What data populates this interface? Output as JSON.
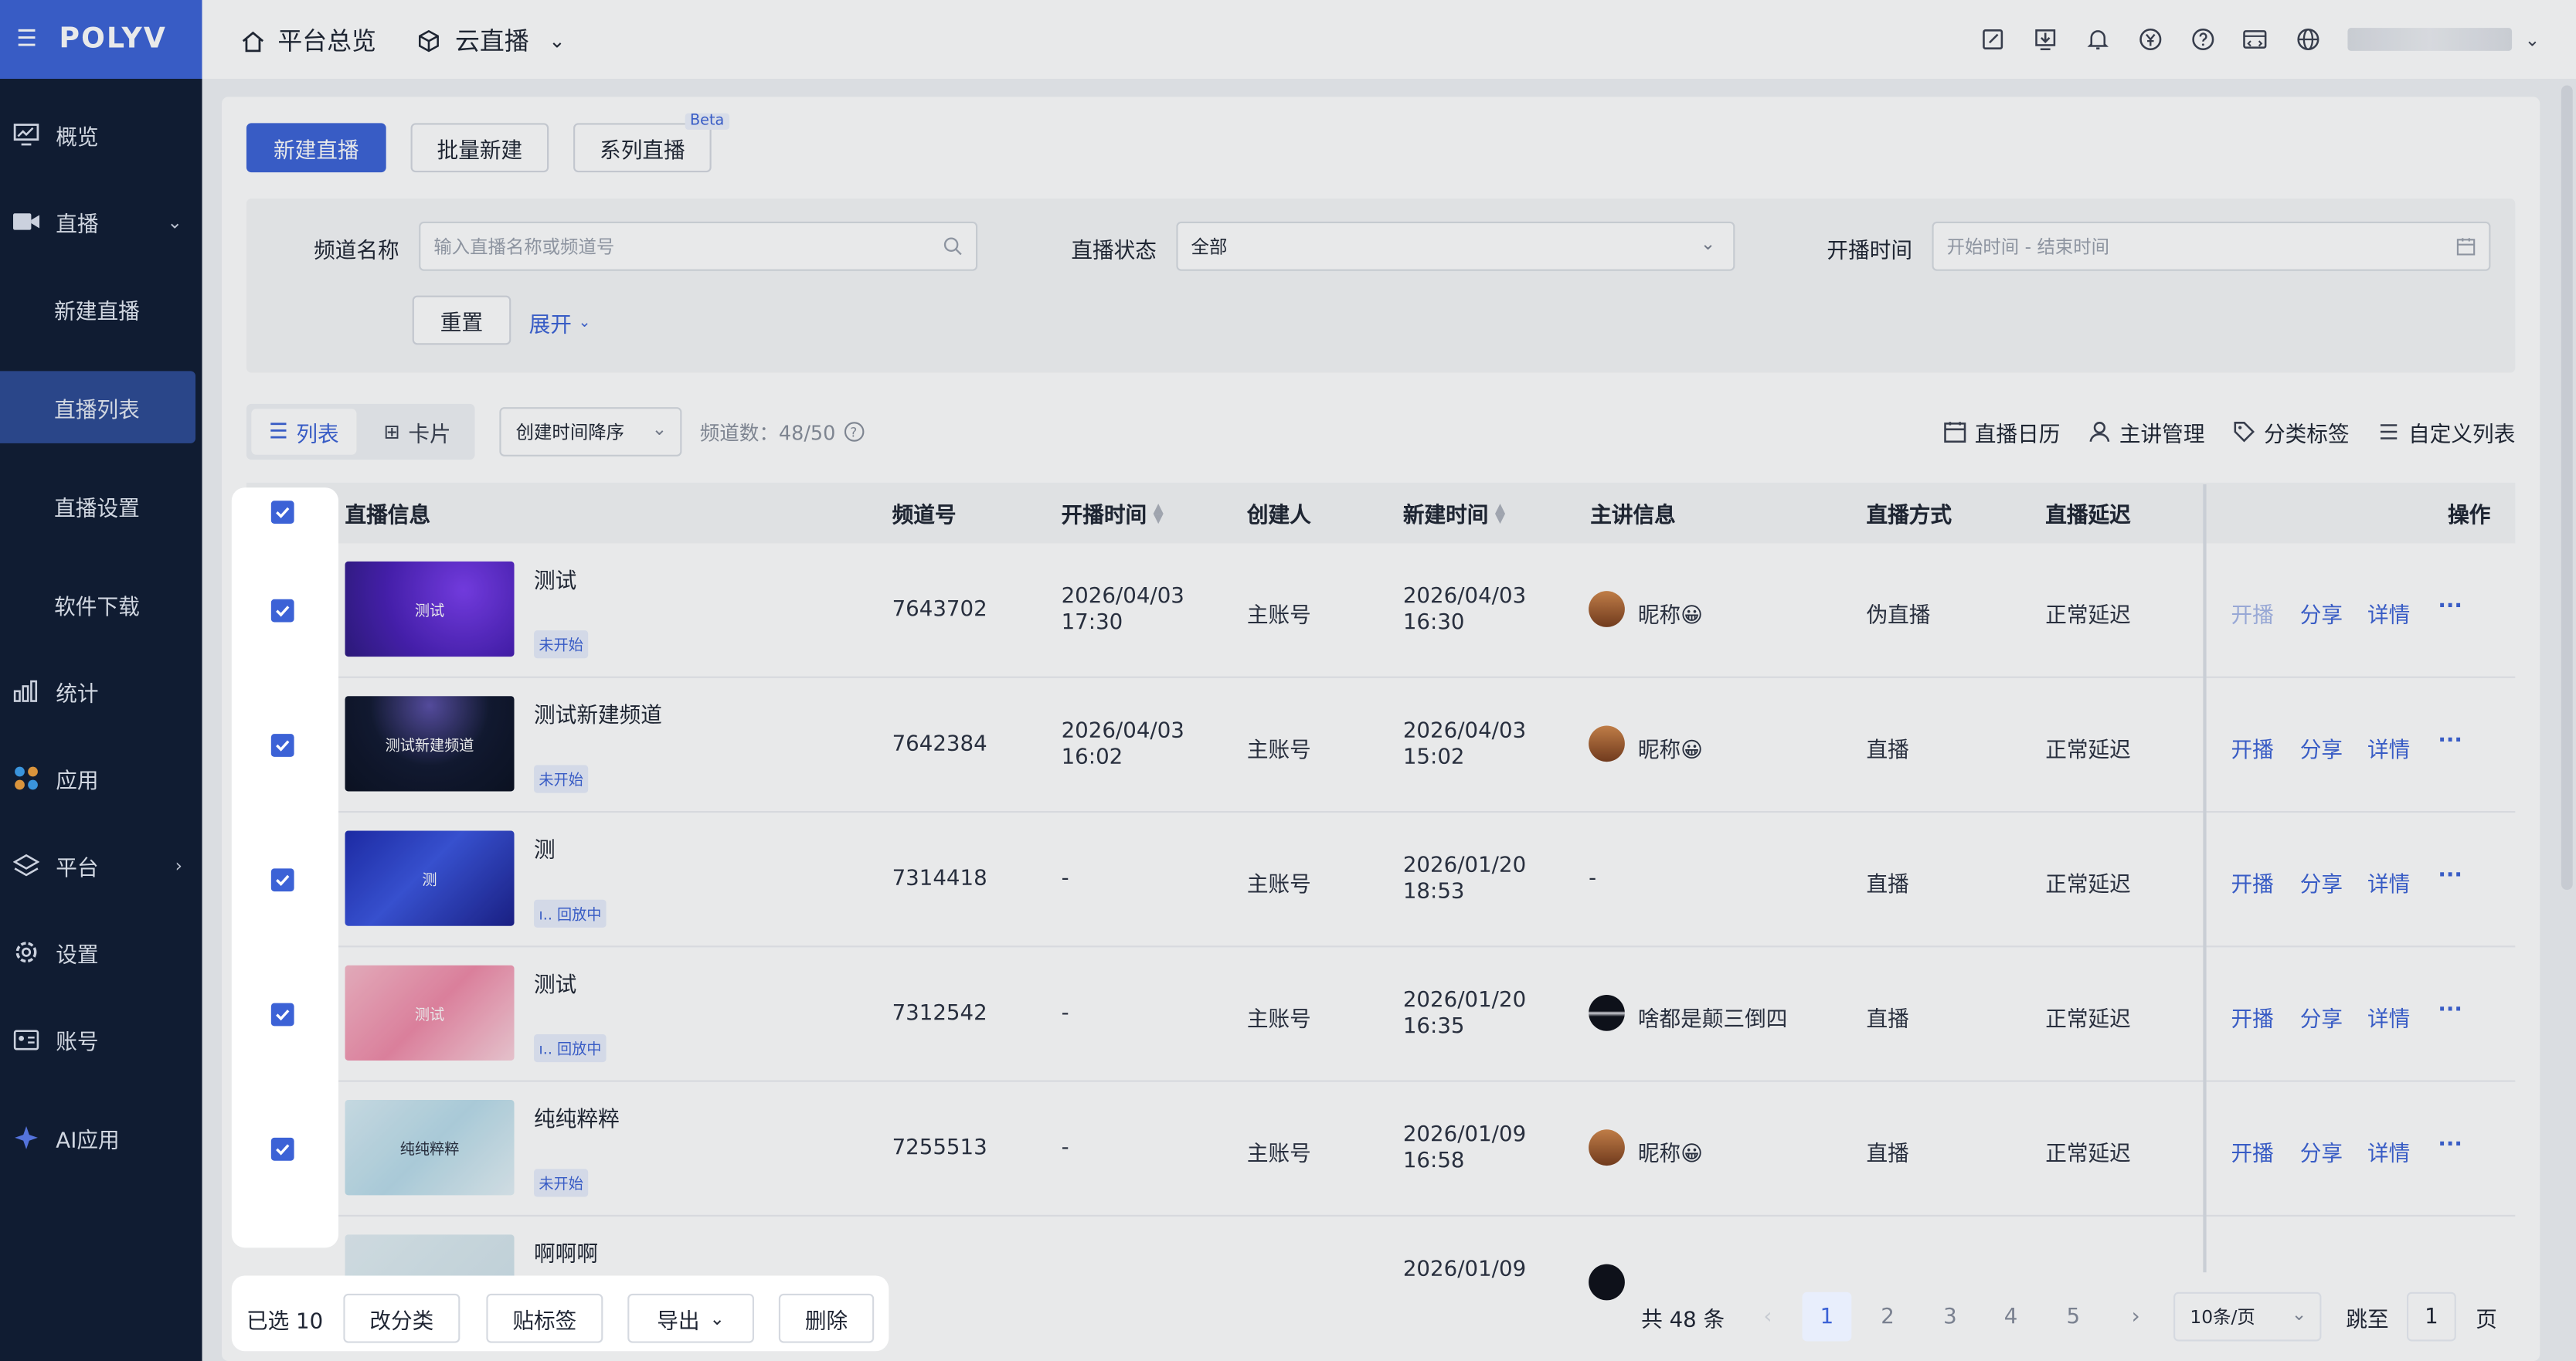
{
  "app": {
    "logo": "POLYV"
  },
  "topbar": {
    "home_label": "平台总览",
    "product_label": "云直播"
  },
  "sidebar": {
    "items": [
      {
        "label": "概览"
      },
      {
        "label": "直播"
      },
      {
        "label": "新建直播"
      },
      {
        "label": "直播列表"
      },
      {
        "label": "直播设置"
      },
      {
        "label": "软件下载"
      },
      {
        "label": "统计"
      },
      {
        "label": "应用"
      },
      {
        "label": "平台"
      },
      {
        "label": "设置"
      },
      {
        "label": "账号"
      },
      {
        "label": "AI应用"
      }
    ]
  },
  "actions": {
    "new_live": "新建直播",
    "batch_new": "批量新建",
    "series_live": "系列直播",
    "beta": "Beta"
  },
  "filters": {
    "channel_name_label": "频道名称",
    "channel_name_placeholder": "输入直播名称或频道号",
    "status_label": "直播状态",
    "status_value": "全部",
    "time_label": "开播时间",
    "time_placeholder": "开始时间 - 结束时间",
    "reset": "重置",
    "expand": "展开"
  },
  "view": {
    "list": "列表",
    "card": "卡片",
    "sort_value": "创建时间降序",
    "count": "频道数：48/50"
  },
  "tools": {
    "calendar": "直播日历",
    "lecturer": "主讲管理",
    "tags": "分类标签",
    "custom": "自定义列表"
  },
  "table": {
    "headers": {
      "info": "直播信息",
      "channel": "频道号",
      "start_time": "开播时间",
      "creator": "创建人",
      "created": "新建时间",
      "lecturer": "主讲信息",
      "mode": "直播方式",
      "latency": "直播延迟",
      "ops": "操作"
    },
    "rows": [
      {
        "thumb_text": "测试",
        "title": "测试",
        "status": "未开始",
        "channel": "7643702",
        "start_date": "2026/04/03",
        "start_clock": "17:30",
        "creator": "主账号",
        "created_date": "2026/04/03",
        "created_clock": "16:30",
        "lecturer": "昵称😀",
        "mode": "伪直播",
        "latency": "正常延迟"
      },
      {
        "thumb_text": "测试新建频道",
        "title": "测试新建频道",
        "status": "未开始",
        "channel": "7642384",
        "start_date": "2026/04/03",
        "start_clock": "16:02",
        "creator": "主账号",
        "created_date": "2026/04/03",
        "created_clock": "15:02",
        "lecturer": "昵称😀",
        "mode": "直播",
        "latency": "正常延迟"
      },
      {
        "thumb_text": "测",
        "title": "测",
        "status": "ı.. 回放中",
        "channel": "7314418",
        "start_date": "-",
        "start_clock": "",
        "creator": "主账号",
        "created_date": "2026/01/20",
        "created_clock": "18:53",
        "lecturer": "-",
        "mode": "直播",
        "latency": "正常延迟"
      },
      {
        "thumb_text": "测试",
        "title": "测试",
        "status": "ı.. 回放中",
        "channel": "7312542",
        "start_date": "-",
        "start_clock": "",
        "creator": "主账号",
        "created_date": "2026/01/20",
        "created_clock": "16:35",
        "lecturer": "啥都是颠三倒四",
        "mode": "直播",
        "latency": "正常延迟"
      },
      {
        "thumb_text": "纯纯粹粹",
        "title": "纯纯粹粹",
        "status": "未开始",
        "channel": "7255513",
        "start_date": "-",
        "start_clock": "",
        "creator": "主账号",
        "created_date": "2026/01/09",
        "created_clock": "16:58",
        "lecturer": "昵称😀",
        "mode": "直播",
        "latency": "正常延迟"
      },
      {
        "title": "啊啊啊",
        "created_date": "2026/01/09"
      }
    ],
    "ops": {
      "start": "开播",
      "share": "分享",
      "detail": "详情",
      "more": "···"
    }
  },
  "bulk": {
    "selected": "已选 10",
    "reclassify": "改分类",
    "tag": "贴标签",
    "export": "导出",
    "delete": "删除"
  },
  "pagination": {
    "total": "共 48 条",
    "pages": [
      "1",
      "2",
      "3",
      "4",
      "5"
    ],
    "current": "1",
    "page_size": "10条/页",
    "jump_label": "跳至",
    "jump_value": "1",
    "page_unit": "页"
  },
  "colors": {
    "accent": "#3c62d6",
    "sidebar": "#0f1b33"
  }
}
